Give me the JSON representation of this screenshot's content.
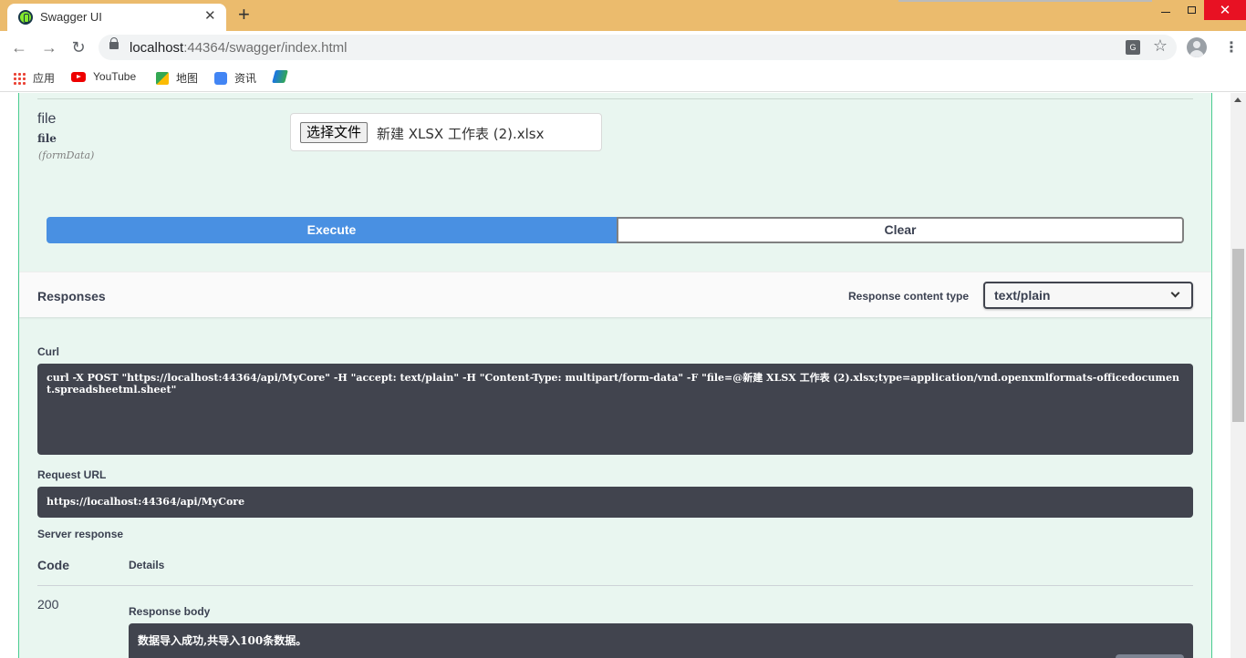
{
  "browser": {
    "tab_title": "Swagger UI",
    "tab_close": "✕",
    "new_tab": "+",
    "url_host": "localhost",
    "url_rest": ":44364/swagger/index.html",
    "bookmarks": [
      {
        "label": "应用",
        "icon": "apps-icon"
      },
      {
        "label": "YouTube",
        "icon": "youtube-icon"
      },
      {
        "label": "地图",
        "icon": "maps-icon"
      },
      {
        "label": "资讯",
        "icon": "news-icon"
      },
      {
        "label": "",
        "icon": "bookmark-icon"
      }
    ]
  },
  "parameter": {
    "name": "file",
    "type": "file",
    "in": "(formData)",
    "choose_button": "选择文件",
    "chosen_file": "新建 XLSX 工作表 (2).xlsx"
  },
  "actions": {
    "execute": "Execute",
    "clear": "Clear"
  },
  "responses": {
    "title": "Responses",
    "content_type_label": "Response content type",
    "content_type_value": "text/plain"
  },
  "curl": {
    "label": "Curl",
    "command": "curl -X POST \"https://localhost:44364/api/MyCore\" -H \"accept: text/plain\" -H \"Content-Type: multipart/form-data\" -F \"file=@新建 XLSX 工作表 (2).xlsx;type=application/vnd.openxmlformats-officedocument.spreadsheetml.sheet\""
  },
  "request_url": {
    "label": "Request URL",
    "value": "https://localhost:44364/api/MyCore"
  },
  "server_response": {
    "label": "Server response",
    "code_header": "Code",
    "details_header": "Details",
    "code": "200",
    "body_label": "Response body",
    "body": "数据导入成功,共导入100条数据。"
  }
}
